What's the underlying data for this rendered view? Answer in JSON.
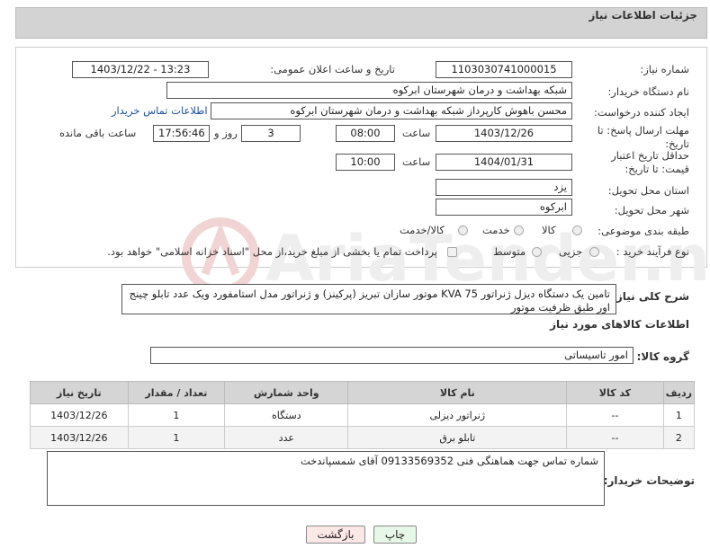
{
  "header": {
    "title": "جزئیات اطلاعات نیاز"
  },
  "form": {
    "need_number_label": "شماره نیاز:",
    "need_number": "1103030741000015",
    "announce_label": "تاریخ و ساعت اعلان عمومی:",
    "announce_value": "1403/12/22 - 13:23",
    "buyer_label": "نام دستگاه خریدار:",
    "buyer_value": "شبکه بهداشت و درمان شهرستان ابرکوه",
    "creator_label": "ایجاد کننده درخواست:",
    "creator_value": "محسن باهوش کارپرداز شبکه بهداشت و درمان شهرستان ابرکوه",
    "contact_link": "اطلاعات تماس خریدار",
    "deadline_label": "مهلت ارسال پاسخ: تا تاریخ:",
    "deadline_date": "1403/12/26",
    "hour_label": "ساعت",
    "deadline_time": "08:00",
    "days_value": "3",
    "days_label": "روز و",
    "remaining_time": "17:56:46",
    "remaining_label": "ساعت باقی مانده",
    "validity_label": "حداقل تاریخ اعتبار قیمت: تا تاریخ:",
    "validity_date": "1404/01/31",
    "validity_time": "10:00",
    "province_label": "استان محل تحویل:",
    "province_value": "یزد",
    "city_label": "شهر محل تحویل:",
    "city_value": "ابرکوه",
    "category_label": "طبقه بندی موضوعی:",
    "category_options": [
      "کالا",
      "خدمت",
      "کالا/خدمت"
    ],
    "process_label": "نوع فرآیند خرید :",
    "process_options": [
      "جزیی",
      "متوسط"
    ],
    "payment_note": "پرداخت تمام یا بخشی از مبلغ خرید،از محل \"اسناد خزانه اسلامی\" خواهد بود."
  },
  "description": {
    "label": "شرح کلی نیاز:",
    "value": "تامین یک دستگاه دیزل ژنراتور KVA 75  موتور سازان تبریز (پرکینز) و ژنراتور مدل استامفورد  ویک عدد تابلو چینج اور طبق ظرفیت موتور"
  },
  "goods": {
    "section_title": "اطلاعات کالاهای مورد نیاز",
    "group_label": "گروه کالا:",
    "group_value": "امور تاسیساتی",
    "columns": [
      "ردیف",
      "کد کالا",
      "نام کالا",
      "واحد شمارش",
      "تعداد / مقدار",
      "تاریخ نیاز"
    ],
    "rows": [
      [
        "1",
        "--",
        "ژنراتور دیزلی",
        "دستگاه",
        "1",
        "1403/12/26"
      ],
      [
        "2",
        "--",
        "تابلو برق",
        "عدد",
        "1",
        "1403/12/26"
      ]
    ]
  },
  "buyer_notes": {
    "label": "توضیحات خریدار:",
    "value": "شماره تماس جهت هماهنگی فنی  09133569352 آقای شمسپاندخت"
  },
  "buttons": {
    "print": "چاپ",
    "back": "بازگشت"
  },
  "colors": {
    "header_bg": "#d3d3d3",
    "link": "#1a4fa0",
    "back_bg": "#fde8e8",
    "print_bg": "#e8f8e8"
  }
}
